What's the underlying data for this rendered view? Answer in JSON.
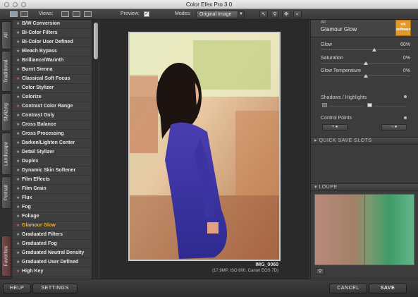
{
  "window": {
    "title": "Color Efex Pro 3.0"
  },
  "toolbar": {
    "views_label": "Views:",
    "preview_label": "Preview:",
    "preview_checked": "✓",
    "modes_label": "Modes:",
    "mode_value": "Original Image"
  },
  "side_tabs": [
    "All",
    "Traditional",
    "Stylizing",
    "Landscape",
    "Portrait",
    "Favorites"
  ],
  "filters": [
    {
      "label": "B/W Conversion",
      "favorite": false
    },
    {
      "label": "Bi-Color Filters",
      "favorite": false
    },
    {
      "label": "Bi-Color User Defined",
      "favorite": false
    },
    {
      "label": "Bleach Bypass",
      "favorite": false
    },
    {
      "label": "Brilliance/Warmth",
      "favorite": false
    },
    {
      "label": "Burnt Sienna",
      "favorite": false
    },
    {
      "label": "Classical Soft Focus",
      "favorite": true
    },
    {
      "label": "Color Stylizer",
      "favorite": false
    },
    {
      "label": "Colorize",
      "favorite": false
    },
    {
      "label": "Contrast Color Range",
      "favorite": true
    },
    {
      "label": "Contrast Only",
      "favorite": false
    },
    {
      "label": "Cross Balance",
      "favorite": false
    },
    {
      "label": "Cross Processing",
      "favorite": false
    },
    {
      "label": "Darken/Lighten Center",
      "favorite": false
    },
    {
      "label": "Detail Stylizer",
      "favorite": false
    },
    {
      "label": "Duplex",
      "favorite": false
    },
    {
      "label": "Dynamic Skin Softener",
      "favorite": false
    },
    {
      "label": "Film Effects",
      "favorite": false
    },
    {
      "label": "Film Grain",
      "favorite": false
    },
    {
      "label": "Flux",
      "favorite": false
    },
    {
      "label": "Fog",
      "favorite": false
    },
    {
      "label": "Foliage",
      "favorite": false
    },
    {
      "label": "Glamour Glow",
      "favorite": true,
      "active": true
    },
    {
      "label": "Graduated Filters",
      "favorite": false
    },
    {
      "label": "Graduated Fog",
      "favorite": false
    },
    {
      "label": "Graduated Neutral Density",
      "favorite": false
    },
    {
      "label": "Graduated User Defined",
      "favorite": false
    },
    {
      "label": "High Key",
      "favorite": true
    }
  ],
  "preview": {
    "image_name": "IMG_0060",
    "image_info": "(17.9MP, ISO 800, Canon EOS 7D)"
  },
  "right_panel": {
    "category": "All",
    "filter_name": "Glamour Glow",
    "logo_text": "nik software",
    "sliders": [
      {
        "label": "Glow",
        "value": "60%",
        "level": 0.6
      },
      {
        "label": "Saturation",
        "value": "0%",
        "level": 0.5
      },
      {
        "label": "Glow Temperature",
        "value": "0%",
        "level": 0.5
      }
    ],
    "shadows_highlights_label": "Shadows / Highlights",
    "control_points_label": "Control Points",
    "quick_save_label": "QUICK SAVE SLOTS",
    "loupe_label": "LOUPE"
  },
  "bottom": {
    "help": "HELP",
    "settings": "SETTINGS",
    "cancel": "CANCEL",
    "save": "SAVE"
  }
}
